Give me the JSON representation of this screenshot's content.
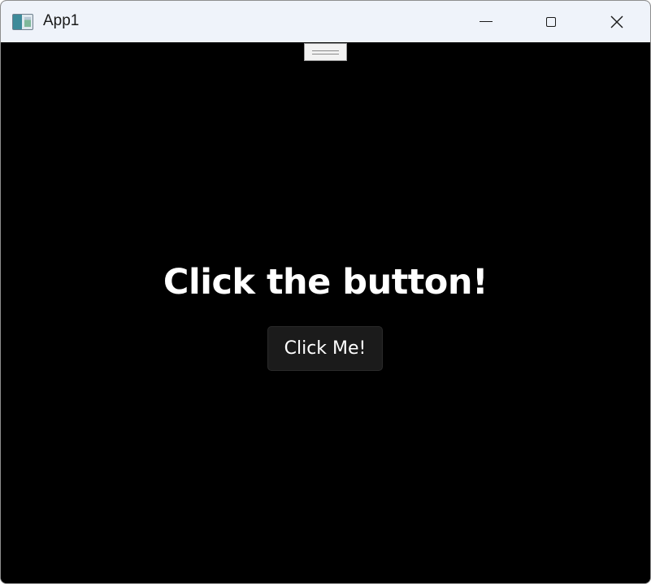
{
  "window": {
    "title": "App1",
    "app_icon": "app-window-icon",
    "controls": {
      "minimize_icon": "minimize-icon",
      "maximize_icon": "maximize-icon",
      "close_icon": "close-icon",
      "close_glyph": "✕"
    }
  },
  "content": {
    "drag_handle_icon": "drag-handle-icon",
    "heading": "Click the button!",
    "button_label": "Click Me!"
  },
  "colors": {
    "titlebar_bg": "#eff3fa",
    "content_bg": "#000000",
    "button_bg": "#1b1b1b",
    "text": "#ffffff"
  }
}
